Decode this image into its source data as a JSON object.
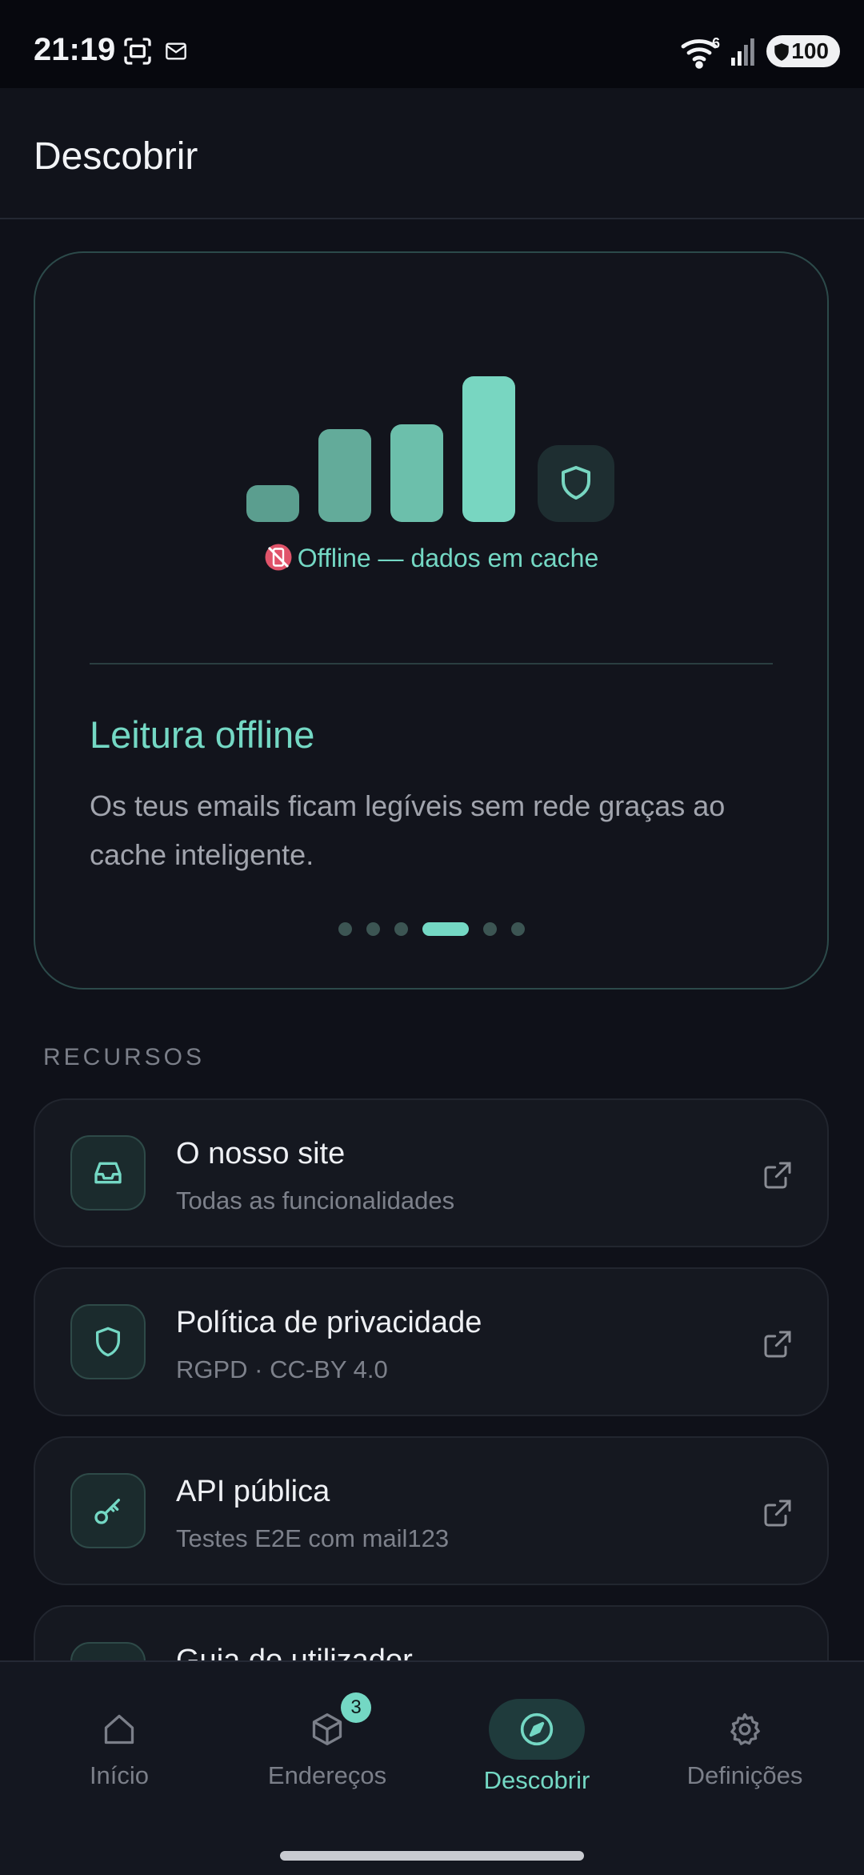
{
  "status": {
    "time": "21:19",
    "wifi_badge": "6",
    "battery": "100"
  },
  "header": {
    "title": "Descobrir"
  },
  "carousel": {
    "offline_status": "Offline — dados em cache",
    "title": "Leitura offline",
    "description": "Os teus emails ficam legíveis sem rede graças ao cache inteligente.",
    "slide_count": 6,
    "active_slide_index": 3
  },
  "resources": {
    "section_label": "RECURSOS",
    "items": [
      {
        "title": "O nosso site",
        "subtitle": "Todas as funcionalidades",
        "icon": "inbox-icon"
      },
      {
        "title": "Política de privacidade",
        "subtitle": "RGPD · CC-BY 4.0",
        "icon": "shield-icon"
      },
      {
        "title": "API pública",
        "subtitle": "Testes E2E com mail123",
        "icon": "key-icon"
      },
      {
        "title": "Guia do utilizador",
        "subtitle": "",
        "icon": "book-icon"
      }
    ]
  },
  "nav": {
    "items": [
      {
        "label": "Início",
        "icon": "home-icon"
      },
      {
        "label": "Endereços",
        "icon": "box-icon",
        "badge": "3"
      },
      {
        "label": "Descobrir",
        "icon": "compass-icon",
        "active": true
      },
      {
        "label": "Definições",
        "icon": "gear-icon"
      }
    ]
  },
  "colors": {
    "accent": "#74d8c4",
    "background": "#0f1119",
    "card": "#151820"
  }
}
